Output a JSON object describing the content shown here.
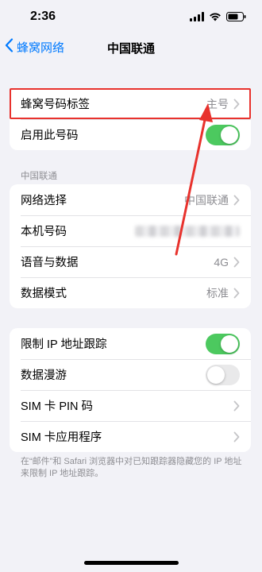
{
  "status_bar": {
    "time": "2:36"
  },
  "nav": {
    "back_label": "蜂窝网络",
    "title": "中国联通"
  },
  "group1": {
    "label_row": {
      "label": "蜂窝号码标签",
      "value": "主号"
    },
    "enable_row": {
      "label": "启用此号码",
      "toggle": "on"
    }
  },
  "carrier_section": {
    "header": "中国联通",
    "network_selection": {
      "label": "网络选择",
      "value": "中国联通"
    },
    "my_number": {
      "label": "本机号码"
    },
    "voice_data": {
      "label": "语音与数据",
      "value": "4G"
    },
    "data_mode": {
      "label": "数据模式",
      "value": "标准"
    }
  },
  "group3": {
    "limit_ip": {
      "label": "限制 IP 地址跟踪",
      "toggle": "on"
    },
    "data_roaming": {
      "label": "数据漫游",
      "toggle": "off"
    },
    "sim_pin": {
      "label": "SIM 卡 PIN 码"
    },
    "sim_apps": {
      "label": "SIM 卡应用程序"
    },
    "footer": "在“邮件”和 Safari 浏览器中对已知跟踪器隐藏您的 IP 地址来限制 IP 地址跟踪。"
  },
  "colors": {
    "accent": "#007aff",
    "toggle_on": "#4cc95f",
    "annotation": "#e8322d"
  }
}
